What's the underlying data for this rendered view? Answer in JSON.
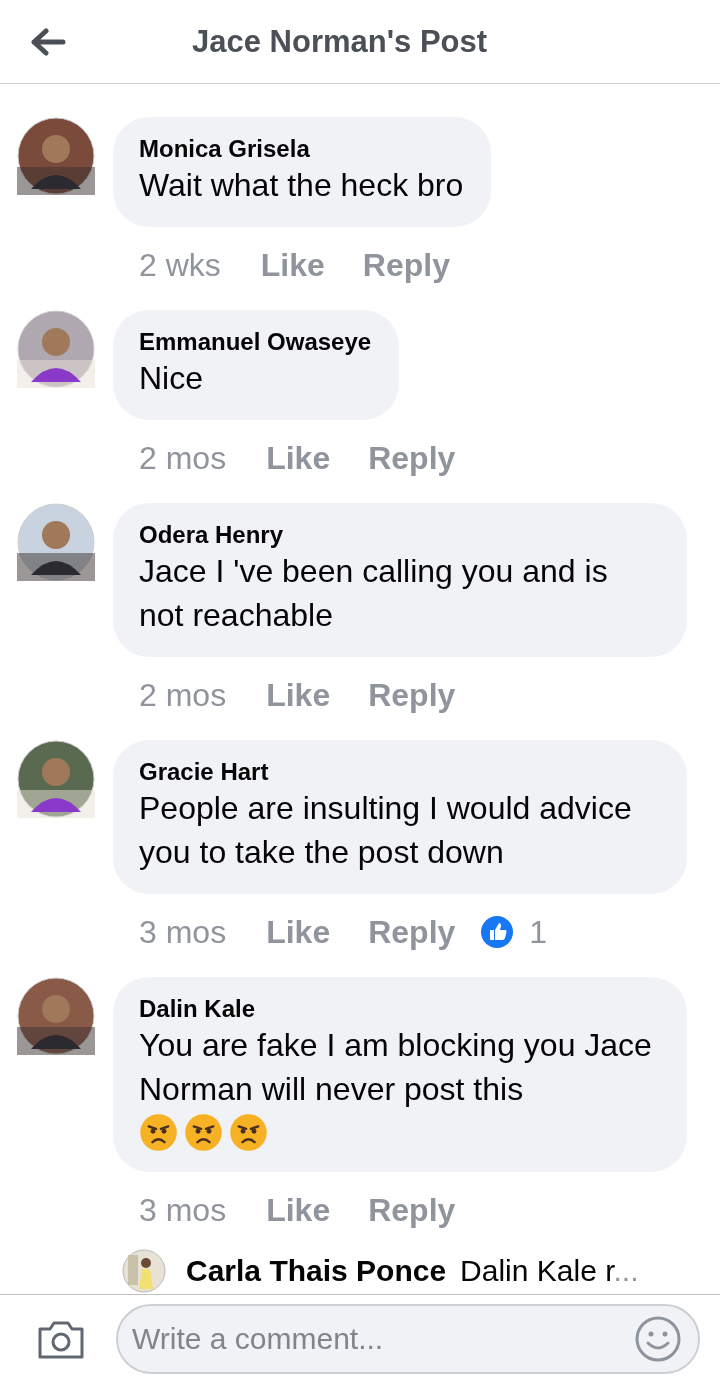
{
  "header": {
    "title": "Jace Norman's Post"
  },
  "comments": [
    {
      "name": "Monica Grisela",
      "text": "Wait what the heck bro",
      "time": "2 wks",
      "like": "Like",
      "reply": "Reply"
    },
    {
      "name": "Emmanuel Owaseye",
      "text": "Nice",
      "time": "2 mos",
      "like": "Like",
      "reply": "Reply"
    },
    {
      "name": "Odera Henry",
      "text": "Jace I 've been calling you and is not reachable",
      "time": "2 mos",
      "like": "Like",
      "reply": "Reply"
    },
    {
      "name": "Gracie Hart",
      "text": "People are insulting I would advice you to take the post down",
      "time": "3 mos",
      "like": "Like",
      "reply": "Reply",
      "reactions": "1"
    },
    {
      "name": "Dalin Kale",
      "text": "You are fake I am blocking you Jace Norman will never post this",
      "time": "3 mos",
      "like": "Like",
      "reply": "Reply",
      "icons": [
        {
          "kind": "angry-face"
        },
        {
          "kind": "angry-face"
        },
        {
          "kind": "angry-face"
        }
      ]
    }
  ],
  "reply_preview": {
    "name": "Carla Thais Ponce",
    "text": "Dalin Kale r",
    "ellipsis": "..."
  },
  "composer": {
    "placeholder": "Write a comment..."
  }
}
